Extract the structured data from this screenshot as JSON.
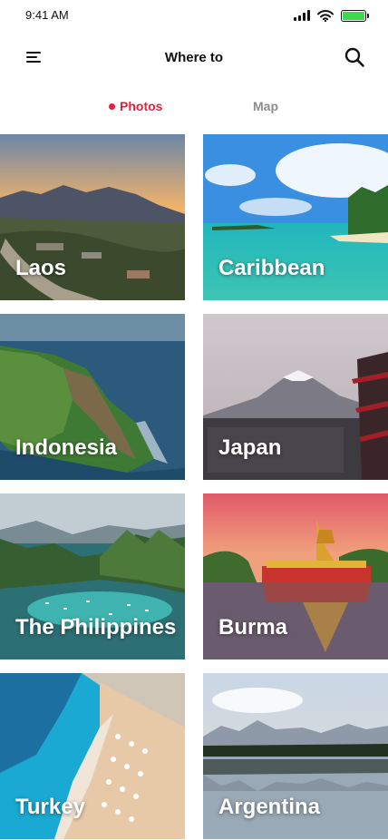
{
  "status_bar": {
    "time": "9:41 AM",
    "battery_color": "#3ed94a",
    "battery_level": 1.0
  },
  "header": {
    "title": "Where to",
    "menu_icon": "hamburger-menu-icon",
    "search_icon": "search-icon"
  },
  "tabs": [
    {
      "label": "Photos",
      "active": true,
      "color": "#e0223f"
    },
    {
      "label": "Map",
      "active": false,
      "color": "#8d8d8d"
    }
  ],
  "destinations": [
    {
      "name": "Laos"
    },
    {
      "name": "Caribbean"
    },
    {
      "name": "Indonesia"
    },
    {
      "name": "Japan"
    },
    {
      "name": "The Philippines"
    },
    {
      "name": "Burma"
    },
    {
      "name": "Turkey"
    },
    {
      "name": "Argentina"
    }
  ]
}
